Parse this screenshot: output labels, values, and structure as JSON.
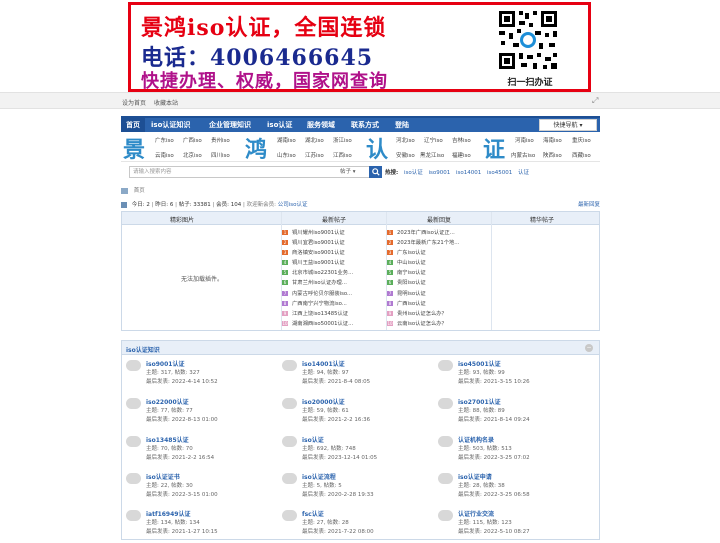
{
  "banner": {
    "line1": "景鸿iso认证，全国连锁",
    "line2": "电话：4006466645",
    "line3": "快捷办理、权威，国家网查询",
    "qr_caption": "扫一扫办证"
  },
  "topbar": {
    "set_home": "设为首页",
    "bookmark": "收藏本站"
  },
  "nav": {
    "items": [
      "首页",
      "iso认证知识",
      "企业管理知识",
      "iso认证",
      "服务领域",
      "联系方式",
      "登陆"
    ],
    "quick": "快捷导航 ▾"
  },
  "cityband": {
    "chars": [
      "景",
      "鸿",
      "认",
      "证"
    ],
    "cities_a": [
      "广东iso",
      "广西iso",
      "贵州iso",
      "云南iso",
      "江苏iso",
      "北京iso",
      "四川iso"
    ],
    "cities_b": [
      "湖南iso",
      "湖北iso",
      "浙江iso",
      "山东iso",
      "江西iso"
    ],
    "cities_c": [
      "河北iso",
      "辽宁iso",
      "吉林iso",
      "安徽iso",
      "黑龙江iso",
      "福建iso"
    ],
    "cities_d": [
      "河南iso",
      "海南iso",
      "重庆iso",
      "内蒙古iso",
      "陕西iso",
      "西藏iso"
    ]
  },
  "search": {
    "placeholder": "请输入搜索内容",
    "scope": "帖子 ▾",
    "hot_label": "热搜:",
    "hot": [
      "iso认证",
      "iso9001",
      "iso14001",
      "iso45001",
      "认证"
    ]
  },
  "crumb": {
    "home": "首页"
  },
  "stats": {
    "today": "今日: 2",
    "yesterday": "昨日: 6",
    "posts": "帖子: 33381",
    "members": "会员: 104",
    "welcome": "欢迎新会员:",
    "new_member": "公司iso认证",
    "latest": "最新回复"
  },
  "box4": {
    "headers": [
      "精彩图片",
      "最新帖子",
      "最新回复",
      "精华帖子"
    ],
    "noplugin": "无法加载插件。",
    "new_posts": [
      "铜川耀州iso9001认证",
      "铜川宜君iso9001认证",
      "商洛镇安iso9001认证",
      "铜川王益iso9001认证",
      "北京市城iso22301业务...",
      "甘肃兰州iso认证办理...",
      "内蒙古呼伦贝尔服装iso...",
      "广西南宁兴宁物流iso...",
      "江西上饶iso13485认证",
      "湖南湘西iso50001认证..."
    ],
    "new_replies": [
      "2023年广西iso认证正...",
      "2023年最新广东21个地...",
      "广东iso认证",
      "中山iso认证",
      "南宁iso认证",
      "贵阳iso认证",
      "昆明iso认证",
      "广西iso认证",
      "贵州iso认证怎么办？",
      "云南iso认证怎么办？"
    ]
  },
  "forum_section": {
    "title": "iso认证知识",
    "forums": [
      {
        "name": "iso9001认证",
        "meta": "主题: 317, 帖数: 327",
        "last": "最后发表: 2022-4-14 10:52"
      },
      {
        "name": "iso14001认证",
        "meta": "主题: 94, 帖数: 97",
        "last": "最后发表: 2021-8-4 08:05"
      },
      {
        "name": "iso45001认证",
        "meta": "主题: 93, 帖数: 99",
        "last": "最后发表: 2021-3-15 10:26"
      },
      {
        "name": "iso22000认证",
        "meta": "主题: 77, 帖数: 77",
        "last": "最后发表: 2022-8-13 01:00"
      },
      {
        "name": "iso20000认证",
        "meta": "主题: 59, 帖数: 61",
        "last": "最后发表: 2021-2-2 16:36"
      },
      {
        "name": "iso27001认证",
        "meta": "主题: 88, 帖数: 89",
        "last": "最后发表: 2021-8-14 09:24"
      },
      {
        "name": "iso13485认证",
        "meta": "主题: 70, 帖数: 70",
        "last": "最后发表: 2021-2-2 16:54"
      },
      {
        "name": "iso认证",
        "meta": "主题: 692, 帖数: 748",
        "last": "最后发表: 2023-12-14 01:05"
      },
      {
        "name": "认证机构名录",
        "meta": "主题: 503, 帖数: 513",
        "last": "最后发表: 2022-3-25 07:02"
      },
      {
        "name": "iso认证证书",
        "meta": "主题: 22, 帖数: 30",
        "last": "最后发表: 2022-3-15 01:00"
      },
      {
        "name": "iso认证流程",
        "meta": "主题: 5, 帖数: 5",
        "last": "最后发表: 2020-2-28 19:33"
      },
      {
        "name": "iso认证申请",
        "meta": "主题: 28, 帖数: 38",
        "last": "最后发表: 2022-3-25 06:58"
      },
      {
        "name": "iatf16949认证",
        "meta": "主题: 134, 帖数: 134",
        "last": "最后发表: 2021-1-27 10:15"
      },
      {
        "name": "fsc认证",
        "meta": "主题: 27, 帖数: 28",
        "last": "最后发表: 2021-7-22 08:00"
      },
      {
        "name": "认证行业交流",
        "meta": "主题: 115, 帖数: 123",
        "last": "最后发表: 2022-5-10 08:27"
      }
    ]
  },
  "colors": {
    "nav": "#2b63ad",
    "banner_border": "#e60012",
    "brand_char": "#2e8bc8"
  }
}
